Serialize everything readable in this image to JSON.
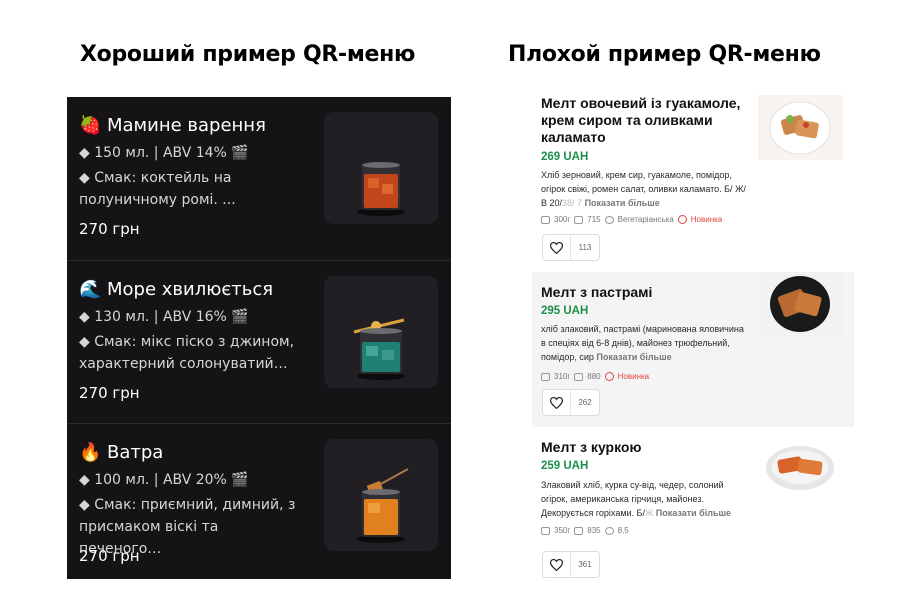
{
  "headings": {
    "good": "Хороший пример QR-меню",
    "bad": "Плохой пример QR-меню"
  },
  "good_menu": {
    "items": [
      {
        "emoji": "🍓",
        "emoji_icon": "strawberry-icon",
        "title": "Мамине варення",
        "meta": "◆ 150 мл. | ABV 14% 🎬",
        "description": "◆ Смак: коктейль на полуничному ромі. ...",
        "price": "270 грн",
        "drink_color": "#c2451b"
      },
      {
        "emoji": "🌊",
        "emoji_icon": "wave-icon",
        "title": "Море хвилюється",
        "meta": "◆ 130 мл. | ABV 16% 🎬",
        "description": "◆ Смак: мікс піско з джином, характерний солонуватий…",
        "price": "270 грн",
        "drink_color": "#1f7f73"
      },
      {
        "emoji": "🔥",
        "emoji_icon": "fire-icon",
        "title": "Ватра",
        "meta": "◆ 100 мл. | ABV 20% 🎬",
        "description": "◆ Смак: приємний, димний, з присмаком віскі та печеного…",
        "price": "270 грн",
        "drink_color": "#e0801f"
      }
    ]
  },
  "bad_menu": {
    "items": [
      {
        "title": "Мелт овочевий із гуакамоле, крем сиром та оливками каламато",
        "price": "269 UAH",
        "description": "Хліб зерновий, крем сир, гуакамоле, помідор, огірок свіжі, ромен салат, оливки каламато. Б/ Ж/ В 20/",
        "description_fade": "38/ 7",
        "more": "Показати більше",
        "weight": "300г",
        "kcal": "715",
        "tag": "Вегетаріанська",
        "badge": "Новинка",
        "likes": "113"
      },
      {
        "title": "Мелт з пастрамі",
        "price": "295 UAH",
        "description": "хліб злаковий, пастрамі (маринована яловичина в спеціях від 6-8 днів), майонез трюфельний, помідор, сир",
        "description_fade": "",
        "more": "Показати більше",
        "weight": "310г",
        "kcal": "880",
        "badge": "Новинка",
        "likes": "262"
      },
      {
        "title": "Мелт з куркою",
        "price": "259 UAH",
        "description": "Злаковий хліб, курка су-від, чедер, солоний огірок, американська гірчиця, майонез. Декорується горіхами. Б/",
        "description_fade": "Ж",
        "more": "Показати більше",
        "weight": "350г",
        "kcal": "835",
        "rating": "8,5",
        "likes": "361"
      }
    ]
  },
  "colors": {
    "dark_bg": "#151316",
    "price_green": "#1d8f4b",
    "badge_red": "#e2453d"
  }
}
